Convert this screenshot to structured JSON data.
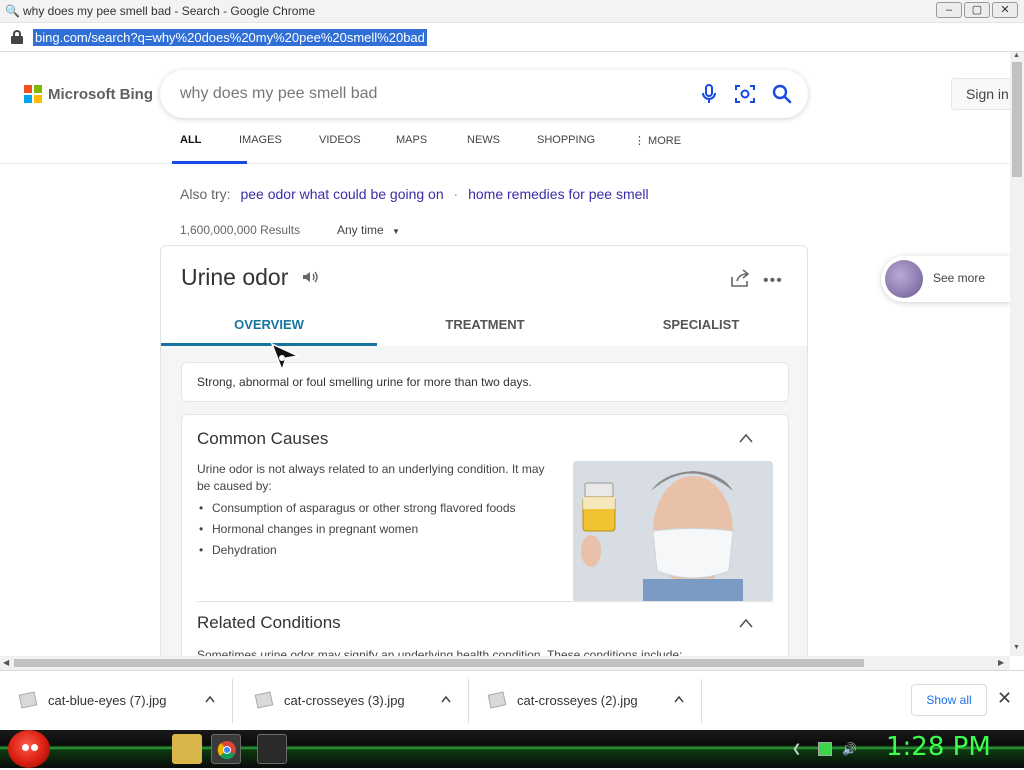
{
  "window": {
    "title": "why does my pee smell bad - Search - Google Chrome",
    "buttons": [
      "–",
      "▢",
      "✕"
    ]
  },
  "address": {
    "url": "bing.com/search?q=why%20does%20my%20pee%20smell%20bad"
  },
  "bing": {
    "logo_text": "Microsoft Bing",
    "logo_colors": [
      "#f25022",
      "#7fba00",
      "#00a4ef",
      "#ffb900"
    ],
    "search_value": "why does my pee smell bad",
    "signin_label": "Sign in",
    "tabs": [
      {
        "label": "ALL",
        "active": true
      },
      {
        "label": "IMAGES",
        "active": false
      },
      {
        "label": "VIDEOS",
        "active": false
      },
      {
        "label": "MAPS",
        "active": false
      },
      {
        "label": "NEWS",
        "active": false
      },
      {
        "label": "SHOPPING",
        "active": false
      },
      {
        "label": "⋮ MORE",
        "active": false
      }
    ],
    "accent": "#174ae4"
  },
  "also_try": {
    "label": "Also try:",
    "links": [
      "pee odor what could be going on",
      "home remedies for pee smell"
    ]
  },
  "results": {
    "count": "1,600,000,000 Results",
    "filter": "Any time"
  },
  "card": {
    "title": "Urine odor",
    "tabs": [
      {
        "label": "OVERVIEW",
        "active": true
      },
      {
        "label": "TREATMENT",
        "active": false
      },
      {
        "label": "SPECIALIST",
        "active": false
      }
    ],
    "tab_accent": "#17749e",
    "summary": "Strong, abnormal or foul smelling urine for more than two days.",
    "causes": {
      "title": "Common Causes",
      "intro": "Urine odor is not always related to an underlying condition. It may be caused by:",
      "items": [
        "Consumption of asparagus or other strong flavored foods",
        "Hormonal changes in pregnant women",
        "Dehydration"
      ]
    },
    "related": {
      "title": "Related Conditions",
      "text": "Sometimes urine odor may signify an underlying health condition. These conditions include:"
    }
  },
  "see_more": {
    "label": "See more"
  },
  "downloads": {
    "items": [
      "cat-blue-eyes (7).jpg",
      "cat-crosseyes (3).jpg",
      "cat-crosseyes (2).jpg"
    ],
    "show_all": "Show all"
  },
  "taskbar": {
    "clock": "1:28 PM",
    "clock_color": "#3bff4c"
  }
}
